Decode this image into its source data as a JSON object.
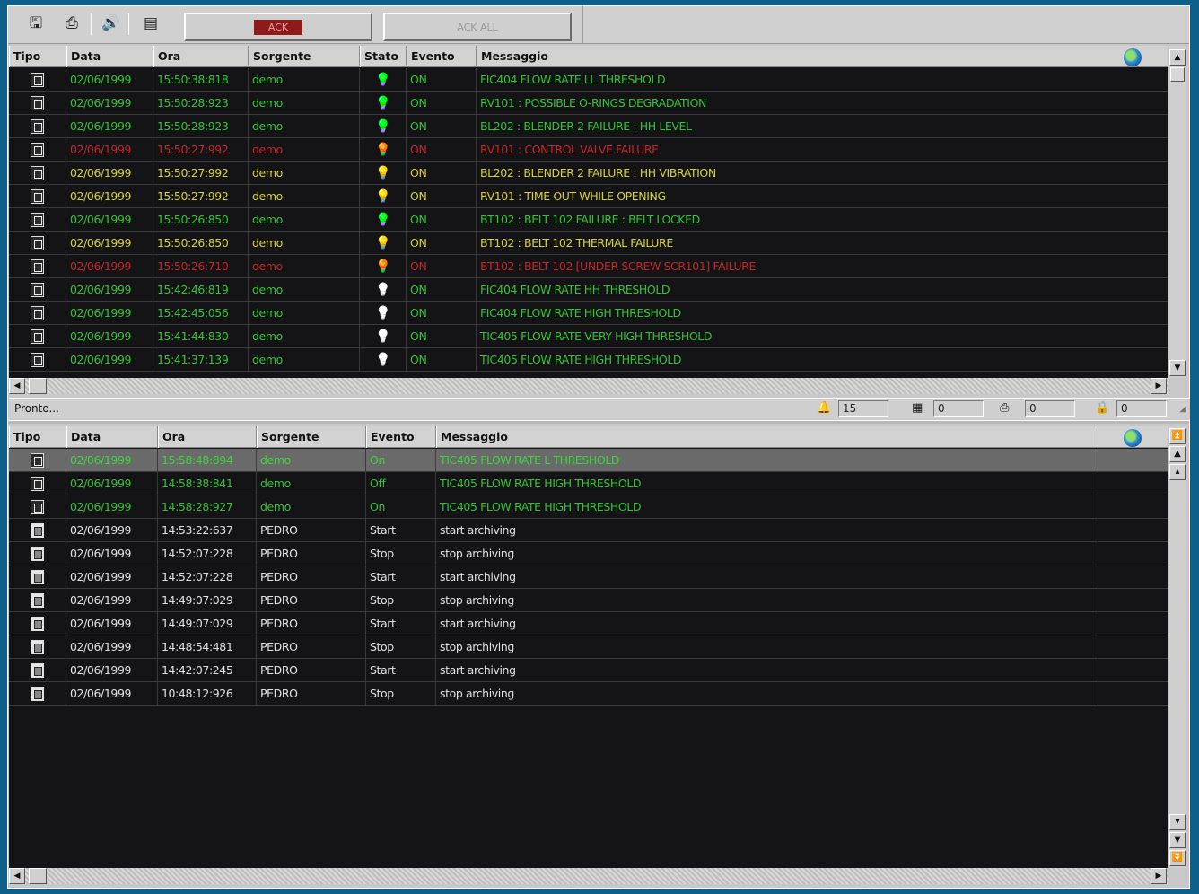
{
  "toolbar": {
    "ack_label": "ACK",
    "ackall_label": "ACK ALL",
    "icons": [
      "save-icon",
      "print-preview-icon",
      "sound-icon",
      "filter-icon"
    ],
    "icon_glyphs": [
      "🖫",
      "⎙",
      "🔊",
      "▤"
    ]
  },
  "colors": {
    "ok": "#36c236",
    "alarm": "#c02828",
    "warning": "#d8d23a",
    "info": "#e2e2e2"
  },
  "alarms": {
    "columns": [
      "Tipo",
      "Data",
      "Ora",
      "Sorgente",
      "Stato",
      "Evento",
      "Messaggio"
    ],
    "rows": [
      {
        "data": "02/06/1999",
        "ora": "15:50:38:818",
        "sorgente": "demo",
        "evento": "ON",
        "messaggio": "FIC404 FLOW RATE LL THRESHOLD",
        "color": "g",
        "bulb": "g"
      },
      {
        "data": "02/06/1999",
        "ora": "15:50:28:923",
        "sorgente": "demo",
        "evento": "ON",
        "messaggio": "RV101 : POSSIBLE O-RINGS DEGRADATION",
        "color": "g",
        "bulb": "g"
      },
      {
        "data": "02/06/1999",
        "ora": "15:50:28:923",
        "sorgente": "demo",
        "evento": "ON",
        "messaggio": "BL202 : BLENDER 2 FAILURE : HH LEVEL",
        "color": "g",
        "bulb": "g"
      },
      {
        "data": "02/06/1999",
        "ora": "15:50:27:992",
        "sorgente": "demo",
        "evento": "ON",
        "messaggio": "RV101 : CONTROL VALVE FAILURE",
        "color": "r",
        "bulb": "r"
      },
      {
        "data": "02/06/1999",
        "ora": "15:50:27:992",
        "sorgente": "demo",
        "evento": "ON",
        "messaggio": "BL202 : BLENDER 2 FAILURE : HH VIBRATION",
        "color": "y",
        "bulb": "y"
      },
      {
        "data": "02/06/1999",
        "ora": "15:50:27:992",
        "sorgente": "demo",
        "evento": "ON",
        "messaggio": "RV101 : TIME OUT WHILE OPENING",
        "color": "y",
        "bulb": "y"
      },
      {
        "data": "02/06/1999",
        "ora": "15:50:26:850",
        "sorgente": "demo",
        "evento": "ON",
        "messaggio": "BT102 : BELT 102 FAILURE : BELT LOCKED",
        "color": "g",
        "bulb": "g"
      },
      {
        "data": "02/06/1999",
        "ora": "15:50:26:850",
        "sorgente": "demo",
        "evento": "ON",
        "messaggio": "BT102 : BELT 102 THERMAL FAILURE",
        "color": "y",
        "bulb": "y"
      },
      {
        "data": "02/06/1999",
        "ora": "15:50:26:710",
        "sorgente": "demo",
        "evento": "ON",
        "messaggio": "BT102 : BELT 102 [UNDER SCREW SCR101] FAILURE",
        "color": "r",
        "bulb": "r"
      },
      {
        "data": "02/06/1999",
        "ora": "15:42:46:819",
        "sorgente": "demo",
        "evento": "ON",
        "messaggio": "FIC404 FLOW RATE HH THRESHOLD",
        "color": "g",
        "bulb": "w"
      },
      {
        "data": "02/06/1999",
        "ora": "15:42:45:056",
        "sorgente": "demo",
        "evento": "ON",
        "messaggio": "FIC404 FLOW RATE HIGH THRESHOLD",
        "color": "g",
        "bulb": "w"
      },
      {
        "data": "02/06/1999",
        "ora": "15:41:44:830",
        "sorgente": "demo",
        "evento": "ON",
        "messaggio": "TIC405 FLOW RATE VERY HIGH THRESHOLD",
        "color": "g",
        "bulb": "w"
      },
      {
        "data": "02/06/1999",
        "ora": "15:41:37:139",
        "sorgente": "demo",
        "evento": "ON",
        "messaggio": "TIC405 FLOW RATE HIGH THRESHOLD",
        "color": "g",
        "bulb": "w"
      }
    ]
  },
  "status": {
    "label": "Pronto...",
    "count1": "15",
    "count2": "0",
    "count3": "0",
    "count4": "0"
  },
  "history": {
    "columns": [
      "Tipo",
      "Data",
      "Ora",
      "Sorgente",
      "Evento",
      "Messaggio"
    ],
    "rows": [
      {
        "data": "02/06/1999",
        "ora": "15:58:48:894",
        "sorgente": "demo",
        "evento": "On",
        "messaggio": "TIC405 FLOW RATE L THRESHOLD",
        "color": "g",
        "kind": "alarm",
        "selected": true
      },
      {
        "data": "02/06/1999",
        "ora": "14:58:38:841",
        "sorgente": "demo",
        "evento": "Off",
        "messaggio": "TIC405 FLOW RATE HIGH THRESHOLD",
        "color": "g",
        "kind": "alarm"
      },
      {
        "data": "02/06/1999",
        "ora": "14:58:28:927",
        "sorgente": "demo",
        "evento": "On",
        "messaggio": "TIC405 FLOW RATE HIGH THRESHOLD",
        "color": "g",
        "kind": "alarm"
      },
      {
        "data": "02/06/1999",
        "ora": "14:53:22:637",
        "sorgente": "PEDRO",
        "evento": "Start",
        "messaggio": "start archiving",
        "color": "w",
        "kind": "arch"
      },
      {
        "data": "02/06/1999",
        "ora": "14:52:07:228",
        "sorgente": "PEDRO",
        "evento": "Stop",
        "messaggio": "stop archiving",
        "color": "w",
        "kind": "arch"
      },
      {
        "data": "02/06/1999",
        "ora": "14:52:07:228",
        "sorgente": "PEDRO",
        "evento": "Start",
        "messaggio": "start archiving",
        "color": "w",
        "kind": "arch"
      },
      {
        "data": "02/06/1999",
        "ora": "14:49:07:029",
        "sorgente": "PEDRO",
        "evento": "Stop",
        "messaggio": "stop archiving",
        "color": "w",
        "kind": "arch"
      },
      {
        "data": "02/06/1999",
        "ora": "14:49:07:029",
        "sorgente": "PEDRO",
        "evento": "Start",
        "messaggio": "start archiving",
        "color": "w",
        "kind": "arch"
      },
      {
        "data": "02/06/1999",
        "ora": "14:48:54:481",
        "sorgente": "PEDRO",
        "evento": "Stop",
        "messaggio": "stop archiving",
        "color": "w",
        "kind": "arch"
      },
      {
        "data": "02/06/1999",
        "ora": "14:42:07:245",
        "sorgente": "PEDRO",
        "evento": "Start",
        "messaggio": "start archiving",
        "color": "w",
        "kind": "arch"
      },
      {
        "data": "02/06/1999",
        "ora": "10:48:12:926",
        "sorgente": "PEDRO",
        "evento": "Stop",
        "messaggio": "stop archiving",
        "color": "w",
        "kind": "arch"
      }
    ]
  }
}
